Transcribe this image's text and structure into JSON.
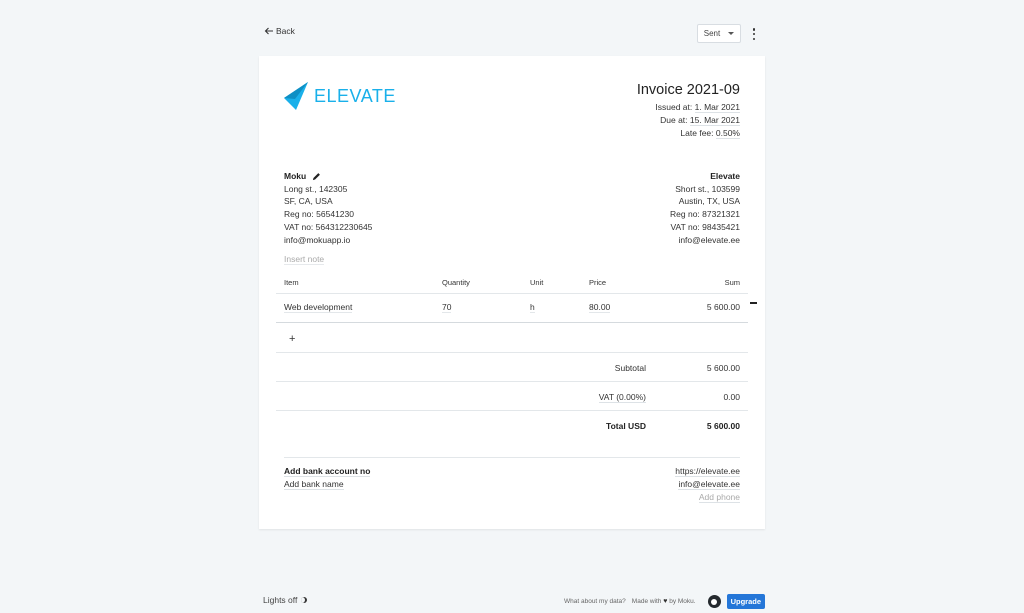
{
  "nav": {
    "back_label": "Back",
    "status_value": "Sent"
  },
  "brand": {
    "name": "ELEVATE",
    "color": "#19b0ea"
  },
  "invoice": {
    "title": "Invoice 2021-09",
    "issued_label": "Issued at:",
    "issued_value": "1. Mar 2021",
    "due_label": "Due at:",
    "due_value": "15. Mar 2021",
    "late_fee_label": "Late fee:",
    "late_fee_value": "0.50%"
  },
  "client": {
    "name": "Moku",
    "street": "Long st., 142305",
    "city": "SF, CA, USA",
    "reg_label": "Reg no:",
    "reg_value": "56541230",
    "vat_label": "VAT no:",
    "vat_value": "564312230645",
    "email": "info@mokuapp.io"
  },
  "sender": {
    "name": "Elevate",
    "street": "Short st., 103599",
    "city": "Austin, TX, USA",
    "reg_label": "Reg no:",
    "reg_value": "87321321",
    "vat_label": "VAT no:",
    "vat_value": "98435421",
    "email": "info@elevate.ee"
  },
  "note_placeholder": "Insert note",
  "table": {
    "headers": {
      "item": "Item",
      "quantity": "Quantity",
      "unit": "Unit",
      "price": "Price",
      "sum": "Sum"
    },
    "rows": [
      {
        "item": "Web development",
        "quantity": "70",
        "unit": "h",
        "price": "80.00",
        "sum": "5 600.00"
      }
    ],
    "add_label": "+"
  },
  "totals": {
    "subtotal_label": "Subtotal",
    "subtotal_value": "5 600.00",
    "vat_label": "VAT (0.00%)",
    "vat_value": "0.00",
    "total_label": "Total USD",
    "total_value": "5 600.00"
  },
  "footer": {
    "bank_account": "Add bank account no",
    "bank_name": "Add bank name",
    "website": "https://elevate.ee",
    "email": "info@elevate.ee",
    "phone": "Add phone"
  },
  "page_footer": {
    "lights": "Lights off",
    "data_link": "What about my data?",
    "made_with": "Made with",
    "by": "by Moku.",
    "upgrade": "Upgrade"
  }
}
